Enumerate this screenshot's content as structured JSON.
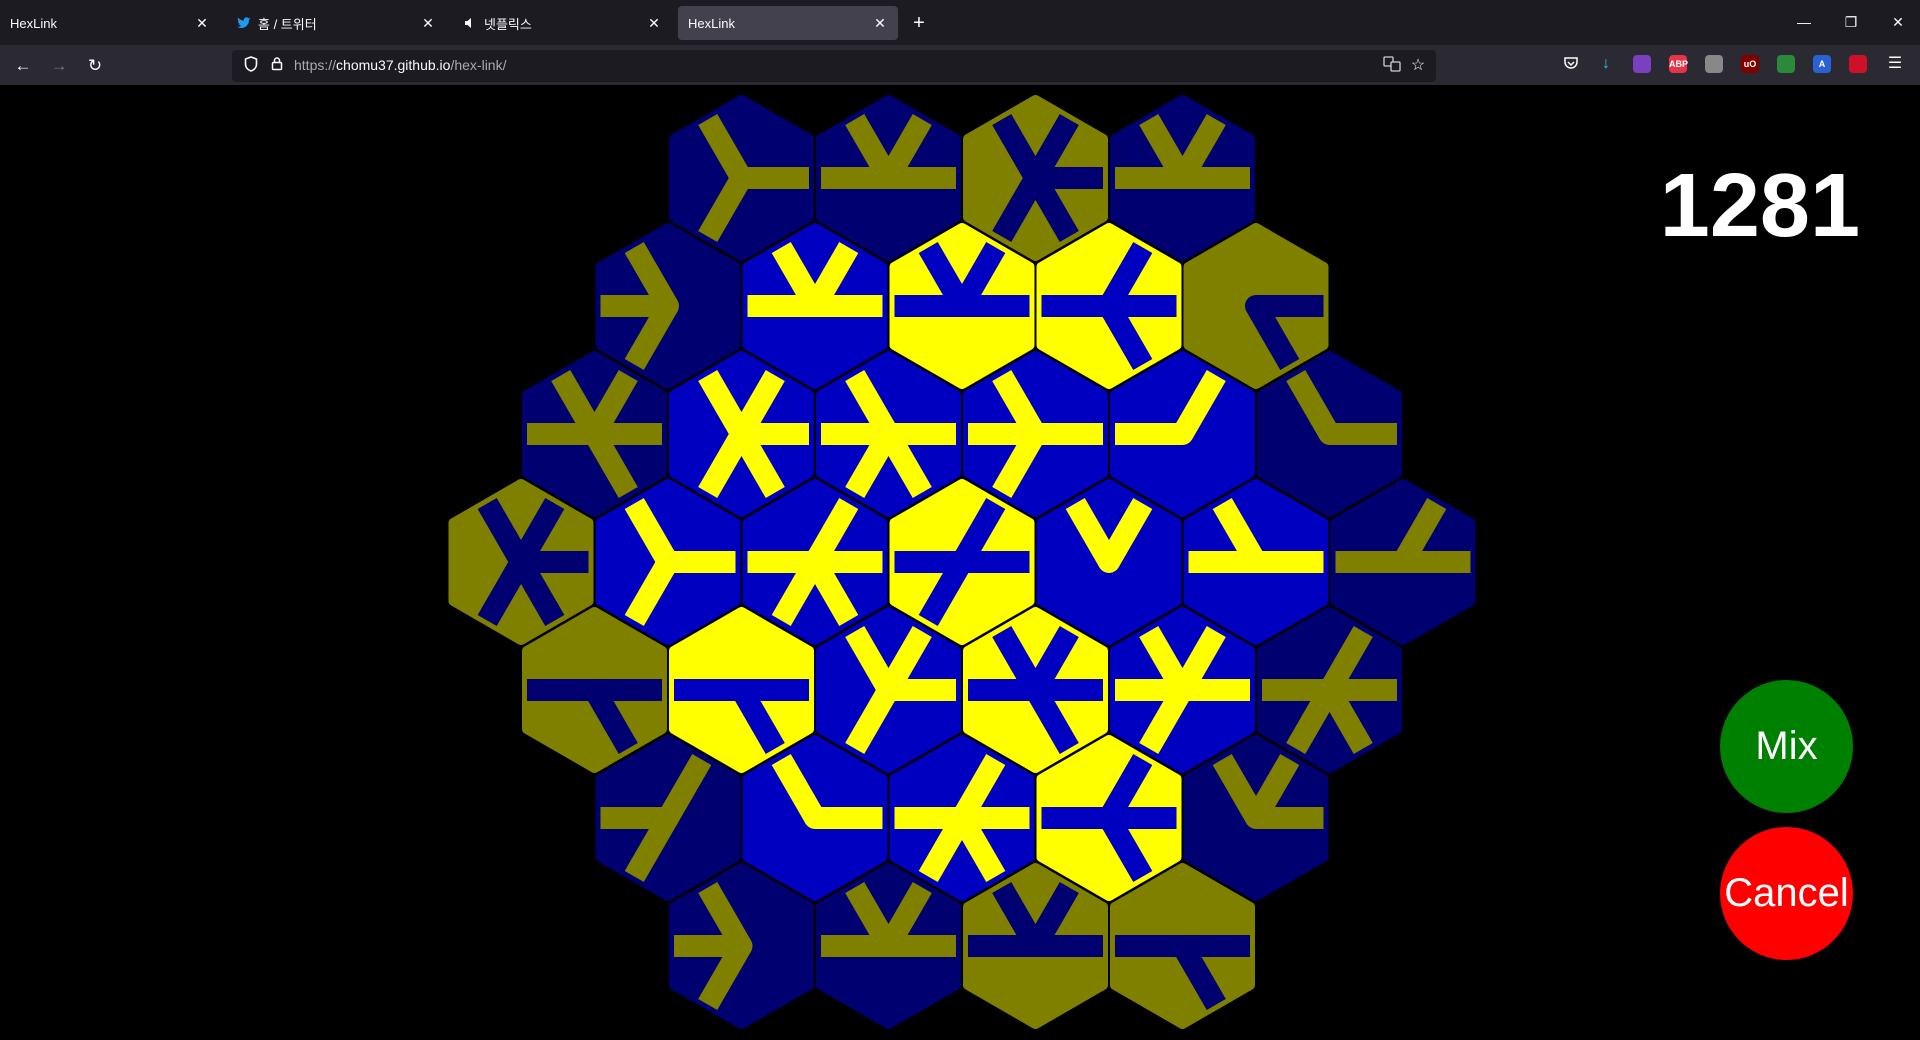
{
  "browser": {
    "tabs": [
      {
        "label": "HexLink",
        "icon": "",
        "active": false
      },
      {
        "label": "홈 / 트위터",
        "icon": "twitter-icon",
        "active": false
      },
      {
        "label": "넷플릭스",
        "icon": "speaker-icon",
        "active": false
      },
      {
        "label": "HexLink",
        "icon": "",
        "active": true
      }
    ],
    "url_prefix": "https://",
    "url_host": "chomu37.github.io",
    "url_path": "/hex-link/",
    "new_tab_glyph": "+",
    "window_controls": {
      "minimize": "—",
      "restore": "❐",
      "close": "✕"
    },
    "nav": {
      "back": "←",
      "forward": "→",
      "reload": "↻"
    },
    "extensions": [
      {
        "name": "pocket-icon",
        "label": "",
        "color": "#2b2a33"
      },
      {
        "name": "download-icon",
        "label": "↓",
        "color": "#2b2a33"
      },
      {
        "name": "color-wheel-icon",
        "label": "",
        "color": "#7b3fbf"
      },
      {
        "name": "adblock-plus-icon",
        "label": "ABP",
        "color": "#e8334a"
      },
      {
        "name": "ghost-icon",
        "label": "",
        "color": "#888888"
      },
      {
        "name": "ublock-origin-icon",
        "label": "uO",
        "color": "#800000"
      },
      {
        "name": "green-extension-icon",
        "label": "",
        "color": "#2a8a3a"
      },
      {
        "name": "translate-extension-icon",
        "label": "A",
        "color": "#2a62d6"
      },
      {
        "name": "red-extension-icon",
        "label": "",
        "color": "#d0102a"
      },
      {
        "name": "menu-icon",
        "label": "☰",
        "color": "#2b2a33"
      }
    ]
  },
  "game": {
    "score": "1281",
    "mix_label": "Mix",
    "cancel_label": "Cancel",
    "colors": {
      "background": "#000000",
      "linked_fill": "#0000c0",
      "linked_line": "#ffff00",
      "dim_fill": "#000070",
      "dim_line": "#808000",
      "mix_button": "#008000",
      "cancel_button": "#ff0000"
    },
    "rows": [
      [
        {
          "state": "dim",
          "base": "blue",
          "arms": [
            0,
            2,
            4
          ]
        },
        {
          "state": "dim",
          "base": "blue",
          "arms": [
            0,
            1,
            2,
            3
          ]
        },
        {
          "state": "dim",
          "base": "yellow",
          "arms": [
            0,
            1,
            2,
            4,
            5
          ]
        },
        {
          "state": "dim",
          "base": "blue",
          "arms": [
            0,
            1,
            2,
            3
          ]
        }
      ],
      [
        {
          "state": "dim",
          "base": "blue",
          "arms": [
            2,
            3,
            4
          ]
        },
        {
          "state": "lit",
          "base": "blue",
          "arms": [
            0,
            1,
            2,
            3
          ]
        },
        {
          "state": "lit",
          "base": "yellow",
          "arms": [
            0,
            1,
            2,
            3
          ]
        },
        {
          "state": "lit",
          "base": "yellow",
          "arms": [
            0,
            1,
            3,
            5
          ]
        },
        {
          "state": "dim",
          "base": "yellow",
          "arms": [
            0,
            5
          ]
        }
      ],
      [
        {
          "state": "dim",
          "base": "blue",
          "arms": [
            0,
            1,
            2,
            3,
            5
          ]
        },
        {
          "state": "lit",
          "base": "blue",
          "arms": [
            0,
            1,
            2,
            4,
            5
          ]
        },
        {
          "state": "lit",
          "base": "blue",
          "arms": [
            0,
            2,
            3,
            4,
            5
          ]
        },
        {
          "state": "lit",
          "base": "blue",
          "arms": [
            0,
            2,
            3,
            4
          ]
        },
        {
          "state": "lit",
          "base": "blue",
          "arms": [
            1,
            3
          ]
        },
        {
          "state": "dim",
          "base": "blue",
          "arms": [
            0,
            2
          ]
        }
      ],
      [
        {
          "state": "dim",
          "base": "yellow",
          "arms": [
            0,
            1,
            2,
            4,
            5
          ]
        },
        {
          "state": "lit",
          "base": "blue",
          "arms": [
            0,
            2,
            4
          ]
        },
        {
          "state": "lit",
          "base": "blue",
          "arms": [
            0,
            1,
            3,
            4,
            5
          ]
        },
        {
          "state": "lit",
          "base": "yellow",
          "arms": [
            0,
            1,
            3,
            4
          ]
        },
        {
          "state": "lit",
          "base": "blue",
          "arms": [
            1,
            2
          ]
        },
        {
          "state": "lit",
          "base": "blue",
          "arms": [
            0,
            2,
            3
          ]
        },
        {
          "state": "dim",
          "base": "blue",
          "arms": [
            0,
            1,
            3
          ]
        }
      ],
      [
        {
          "state": "dim",
          "base": "yellow",
          "arms": [
            0,
            3,
            5
          ]
        },
        {
          "state": "lit",
          "base": "yellow",
          "arms": [
            0,
            3,
            5
          ]
        },
        {
          "state": "lit",
          "base": "blue",
          "arms": [
            0,
            1,
            2,
            4
          ]
        },
        {
          "state": "lit",
          "base": "yellow",
          "arms": [
            0,
            1,
            2,
            3,
            5
          ]
        },
        {
          "state": "lit",
          "base": "blue",
          "arms": [
            0,
            1,
            2,
            3,
            4
          ]
        },
        {
          "state": "dim",
          "base": "blue",
          "arms": [
            0,
            1,
            3,
            4,
            5
          ]
        }
      ],
      [
        {
          "state": "dim",
          "base": "blue",
          "arms": [
            1,
            3,
            4
          ]
        },
        {
          "state": "lit",
          "base": "blue",
          "arms": [
            0,
            2
          ]
        },
        {
          "state": "lit",
          "base": "blue",
          "arms": [
            0,
            1,
            3,
            4,
            5
          ]
        },
        {
          "state": "lit",
          "base": "yellow",
          "arms": [
            0,
            1,
            3,
            5
          ]
        },
        {
          "state": "dim",
          "base": "blue",
          "arms": [
            0,
            1,
            2
          ]
        }
      ],
      [
        {
          "state": "dim",
          "base": "blue",
          "arms": [
            2,
            3,
            4
          ]
        },
        {
          "state": "dim",
          "base": "blue",
          "arms": [
            0,
            1,
            2,
            3
          ]
        },
        {
          "state": "dim",
          "base": "yellow",
          "arms": [
            0,
            1,
            2,
            3
          ]
        },
        {
          "state": "dim",
          "base": "yellow",
          "arms": [
            0,
            3,
            5
          ]
        }
      ]
    ]
  }
}
